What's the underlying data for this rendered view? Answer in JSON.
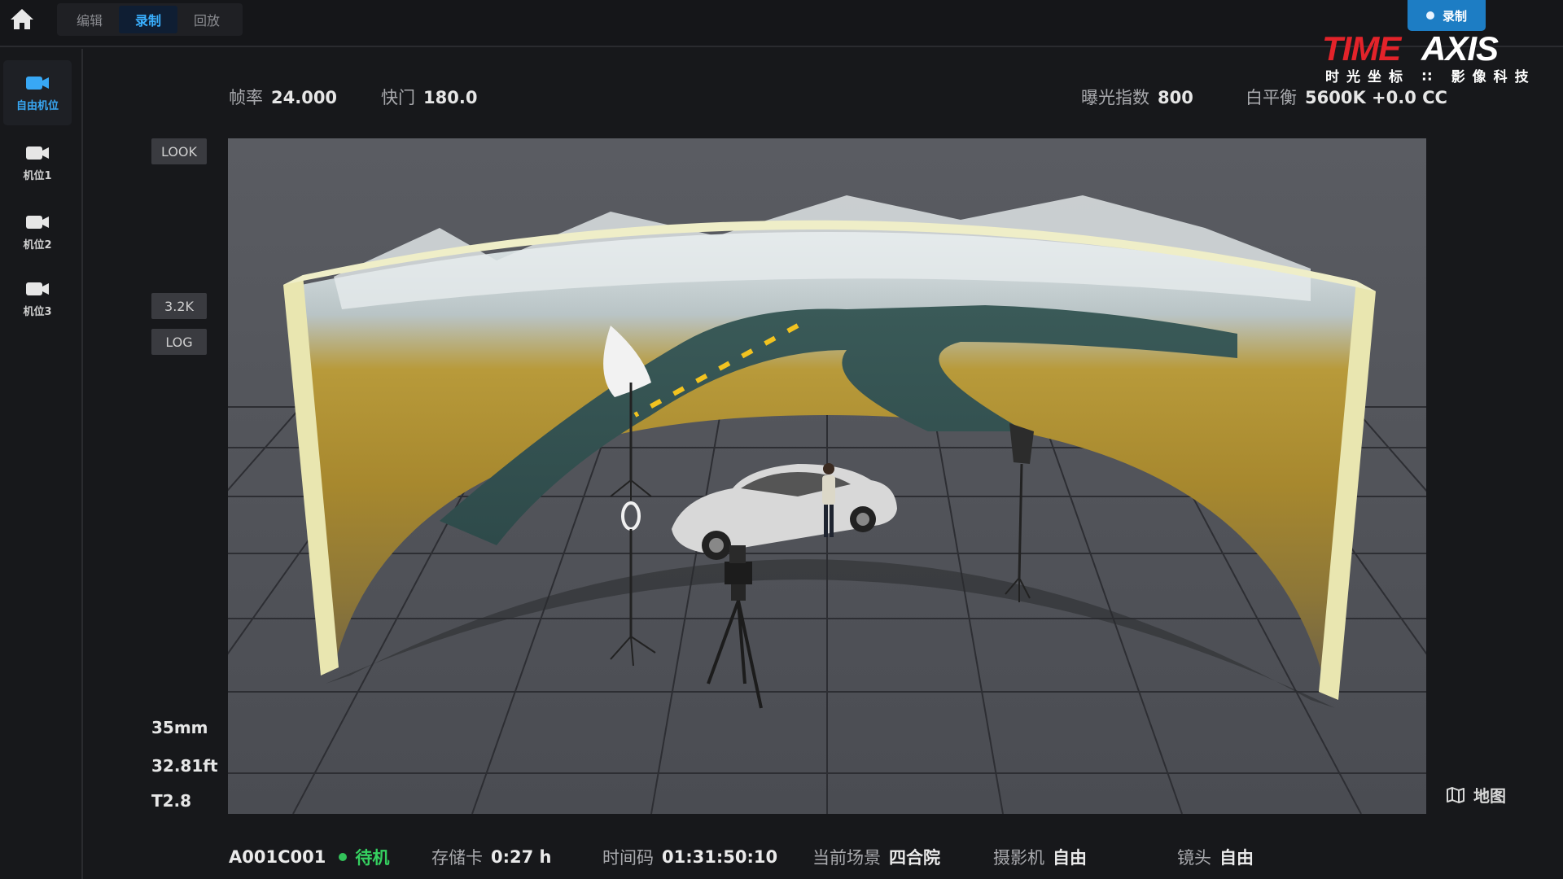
{
  "topbar": {
    "tabs": [
      {
        "label": "编辑",
        "active": false
      },
      {
        "label": "录制",
        "active": true
      },
      {
        "label": "回放",
        "active": false
      }
    ],
    "record_button": "录制",
    "logo_text": "TIMEAXIS",
    "logo_cn": "时光坐标 ∷ 影像科技"
  },
  "sidebar": {
    "items": [
      {
        "label": "自由机位",
        "icon": "camera-icon",
        "active": true
      },
      {
        "label": "机位1",
        "icon": "camera-icon",
        "active": false
      },
      {
        "label": "机位2",
        "icon": "camera-icon",
        "active": false
      },
      {
        "label": "机位3",
        "icon": "camera-icon",
        "active": false
      }
    ]
  },
  "info": {
    "framerate_label": "帧率",
    "framerate": "24.000",
    "shutter_label": "快门",
    "shutter": "180.0",
    "ei_label": "曝光指数",
    "ei": "800",
    "wb_label": "白平衡",
    "wb": "5600K +0.0 CC"
  },
  "side_buttons": {
    "look": "LOOK",
    "resolution": "3.2K",
    "log": "LOG"
  },
  "lens_info": {
    "focal": "35mm",
    "distance": "32.81ft",
    "aperture": "T2.8"
  },
  "map_button": "地图",
  "status": {
    "clip": "A001C001",
    "state": "待机",
    "card_label": "存储卡",
    "card": "0:27 h",
    "tc_label": "时间码",
    "tc": "01:31:50:10",
    "scene_label": "当前场景",
    "scene": "四合院",
    "camera_label": "摄影机",
    "camera": "自由",
    "lens_label": "镜头",
    "lens": "自由"
  },
  "colors": {
    "accent": "#3ab0ff",
    "record": "#1d7dc4",
    "standby": "#35d060",
    "logo_red": "#e3232a"
  }
}
